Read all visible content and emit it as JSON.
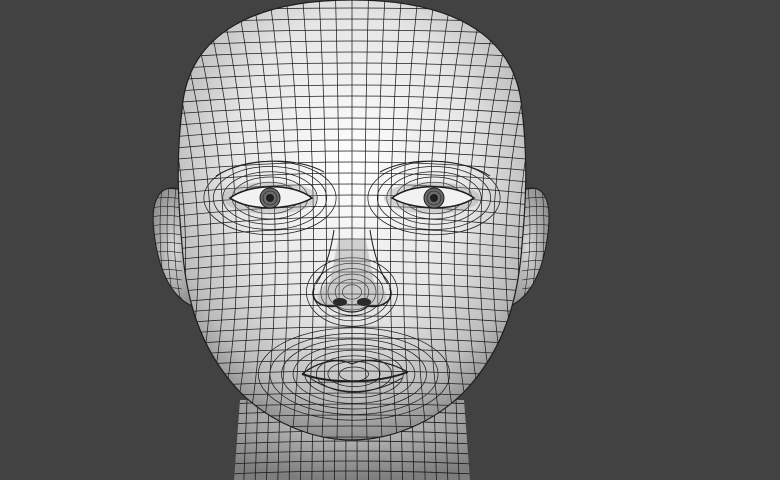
{
  "scene": {
    "background_color": "#424242",
    "surface_color": "#e9e9e9",
    "shadow_color": "#9a9a9a",
    "wire_color": "#1e1e1e",
    "subject": "wireframe-head-model"
  }
}
